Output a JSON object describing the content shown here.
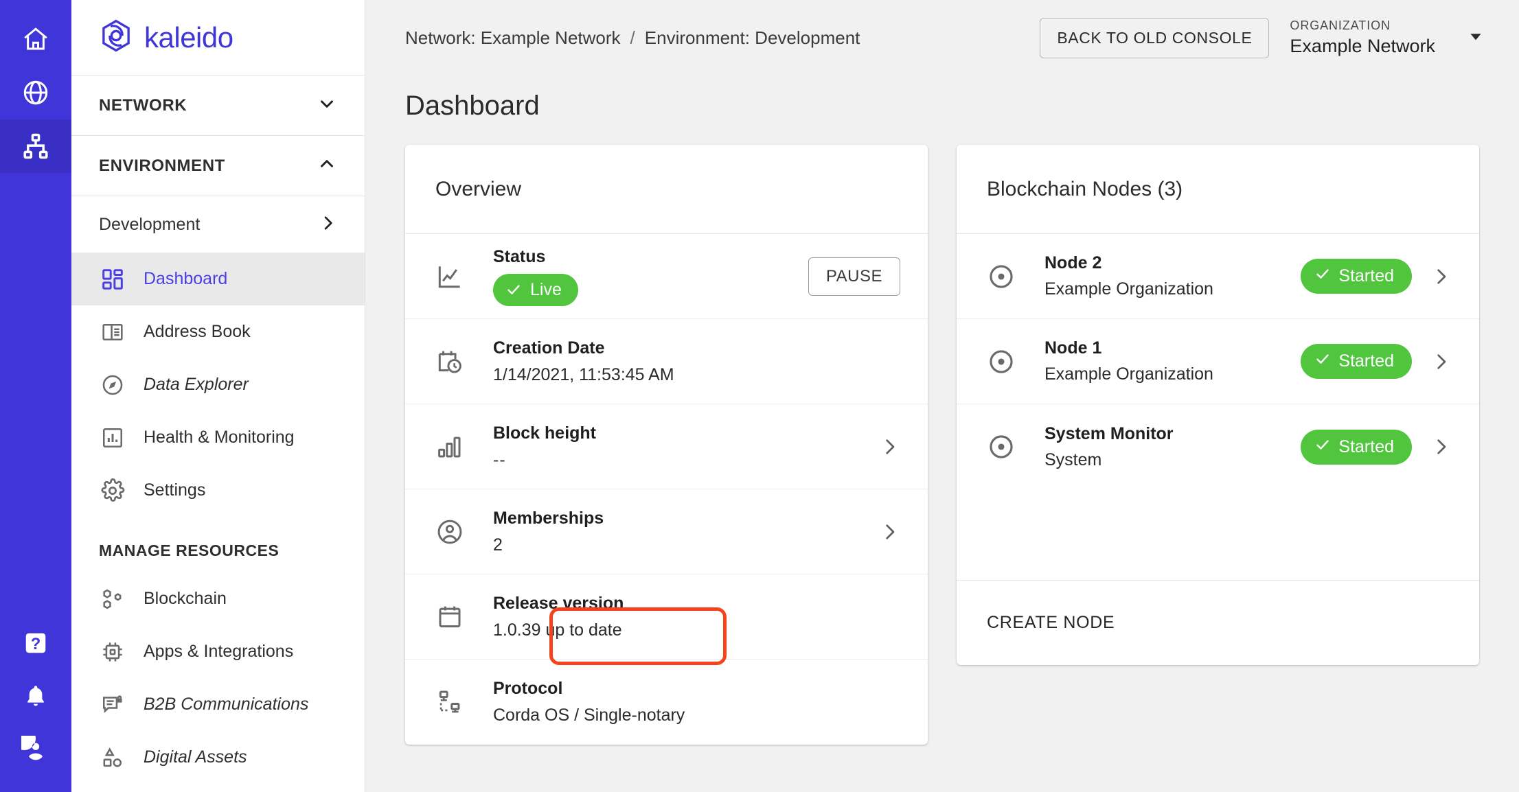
{
  "brand": {
    "name": "kaleido",
    "logo_icon": "kaleido-logo-icon"
  },
  "rail": {
    "items": [
      {
        "name": "home-icon",
        "active": false
      },
      {
        "name": "globe-icon",
        "active": false
      },
      {
        "name": "network-topology-icon",
        "active": true
      }
    ],
    "bottom_items": [
      {
        "name": "help-icon"
      },
      {
        "name": "bell-icon"
      },
      {
        "name": "account-circle-icon"
      }
    ]
  },
  "sidebar": {
    "network_section": {
      "label": "NETWORK",
      "chevron": "chevron-down-icon"
    },
    "environment_section": {
      "label": "ENVIRONMENT",
      "chevron": "chevron-up-icon"
    },
    "environment_item": {
      "label": "Development",
      "chevron": "chevron-right-icon"
    },
    "env_nav": [
      {
        "label": "Dashboard",
        "icon": "dashboard-grid-icon",
        "active": true,
        "muted": false
      },
      {
        "label": "Address Book",
        "icon": "address-book-icon",
        "active": false,
        "muted": false
      },
      {
        "label": "Data Explorer",
        "icon": "compass-icon",
        "active": false,
        "muted": true
      },
      {
        "label": "Health & Monitoring",
        "icon": "bar-chart-icon",
        "active": false,
        "muted": false
      },
      {
        "label": "Settings",
        "icon": "gear-icon",
        "active": false,
        "muted": false
      }
    ],
    "manage_section_label": "MANAGE RESOURCES",
    "manage_nav": [
      {
        "label": "Blockchain",
        "icon": "blockchain-nodes-icon",
        "active": false,
        "muted": false
      },
      {
        "label": "Apps & Integrations",
        "icon": "chip-icon",
        "active": false,
        "muted": false
      },
      {
        "label": "B2B Communications",
        "icon": "secure-message-icon",
        "active": false,
        "muted": true
      },
      {
        "label": "Digital Assets",
        "icon": "shapes-icon",
        "active": false,
        "muted": true
      }
    ]
  },
  "topbar": {
    "breadcrumb_network": "Network: Example Network",
    "breadcrumb_separator": "/",
    "breadcrumb_environment": "Environment: Development",
    "back_to_old_console": "BACK TO OLD CONSOLE",
    "organization_label": "ORGANIZATION",
    "organization_name": "Example Network",
    "organization_chevron": "chevron-down-icon"
  },
  "page": {
    "title": "Dashboard"
  },
  "overview": {
    "title": "Overview",
    "rows": [
      {
        "label": "Status",
        "value": "Live",
        "type": "badge",
        "icon": "line-chart-icon",
        "action": "PAUSE",
        "badge_color": "#52c53f"
      },
      {
        "label": "Creation Date",
        "value": "1/14/2021, 11:53:45 AM",
        "type": "text",
        "icon": "calendar-clock-icon"
      },
      {
        "label": "Block height",
        "value": "--",
        "type": "text",
        "icon": "bar-chart-small-icon",
        "chevron": true
      },
      {
        "label": "Memberships",
        "value": "2",
        "type": "text",
        "icon": "account-circle-outline-icon",
        "chevron": true
      },
      {
        "label": "Release version",
        "value": "1.0.39 up to date",
        "type": "text",
        "icon": "calendar-icon",
        "highlighted": true
      },
      {
        "label": "Protocol",
        "value": "Corda OS / Single-notary",
        "type": "text",
        "icon": "protocol-nodes-icon"
      }
    ]
  },
  "nodes_card": {
    "title": "Blockchain Nodes (3)",
    "count": 3,
    "rows": [
      {
        "name": "Node 2",
        "org": "Example Organization",
        "status": "Started",
        "icon": "node-dot-icon",
        "status_color": "#52c53f"
      },
      {
        "name": "Node 1",
        "org": "Example Organization",
        "status": "Started",
        "icon": "node-dot-icon",
        "status_color": "#52c53f"
      },
      {
        "name": "System Monitor",
        "org": "System",
        "status": "Started",
        "icon": "node-dot-icon",
        "status_color": "#52c53f"
      }
    ],
    "create_node_label": "CREATE NODE"
  },
  "annotation": {
    "color": "#f4441e",
    "target": "Release version"
  },
  "theme": {
    "rail_bg": "#3f35d8",
    "rail_active": "#3a2fc4",
    "accent": "#4b3fe4",
    "page_bg": "#f1f1f1",
    "success": "#52c53f"
  }
}
